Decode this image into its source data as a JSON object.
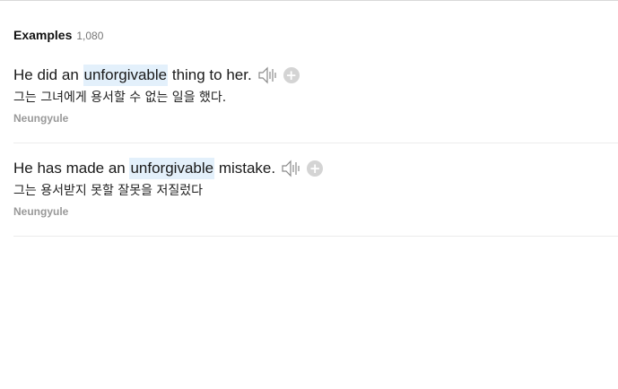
{
  "header": {
    "title": "Examples",
    "count": "1,080"
  },
  "examples": [
    {
      "en_before": "He did an ",
      "en_highlight": "unforgivable",
      "en_after": " thing to her.",
      "ko": "그는 그녀에게 용서할 수 없는 일을 했다.",
      "source": "Neungyule"
    },
    {
      "en_before": "He has made an ",
      "en_highlight": "unforgivable",
      "en_after": " mistake.",
      "ko": "그는 용서받지 못할 잘못을 저질렀다",
      "source": "Neungyule"
    }
  ],
  "icons": {
    "speaker": "speaker-icon",
    "add": "add-icon"
  },
  "colors": {
    "highlight": "#e3f0fb",
    "add_button": "#d4d4d4"
  }
}
